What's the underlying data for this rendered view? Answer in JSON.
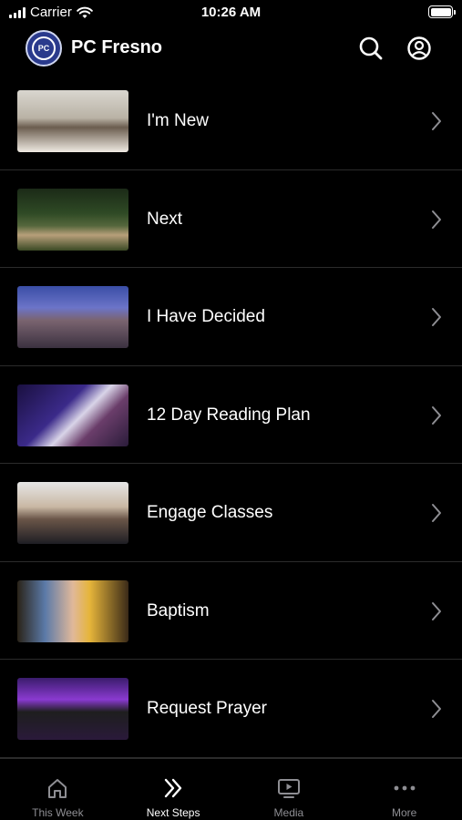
{
  "status_bar": {
    "carrier": "Carrier",
    "time": "10:26 AM"
  },
  "header": {
    "title": "PC Fresno",
    "logo_text": "PC"
  },
  "items": [
    {
      "label": "I'm New"
    },
    {
      "label": "Next"
    },
    {
      "label": "I Have Decided"
    },
    {
      "label": "12 Day Reading Plan"
    },
    {
      "label": "Engage Classes"
    },
    {
      "label": "Baptism"
    },
    {
      "label": "Request Prayer"
    }
  ],
  "tabs": [
    {
      "label": "This Week",
      "icon": "home-icon",
      "active": false
    },
    {
      "label": "Next Steps",
      "icon": "double-chevron-right-icon",
      "active": true
    },
    {
      "label": "Media",
      "icon": "play-screen-icon",
      "active": false
    },
    {
      "label": "More",
      "icon": "ellipsis-icon",
      "active": false
    }
  ],
  "colors": {
    "background": "#000000",
    "text": "#ffffff",
    "inactive_tab": "#8e8e93",
    "logo": "#2a3a8c"
  }
}
